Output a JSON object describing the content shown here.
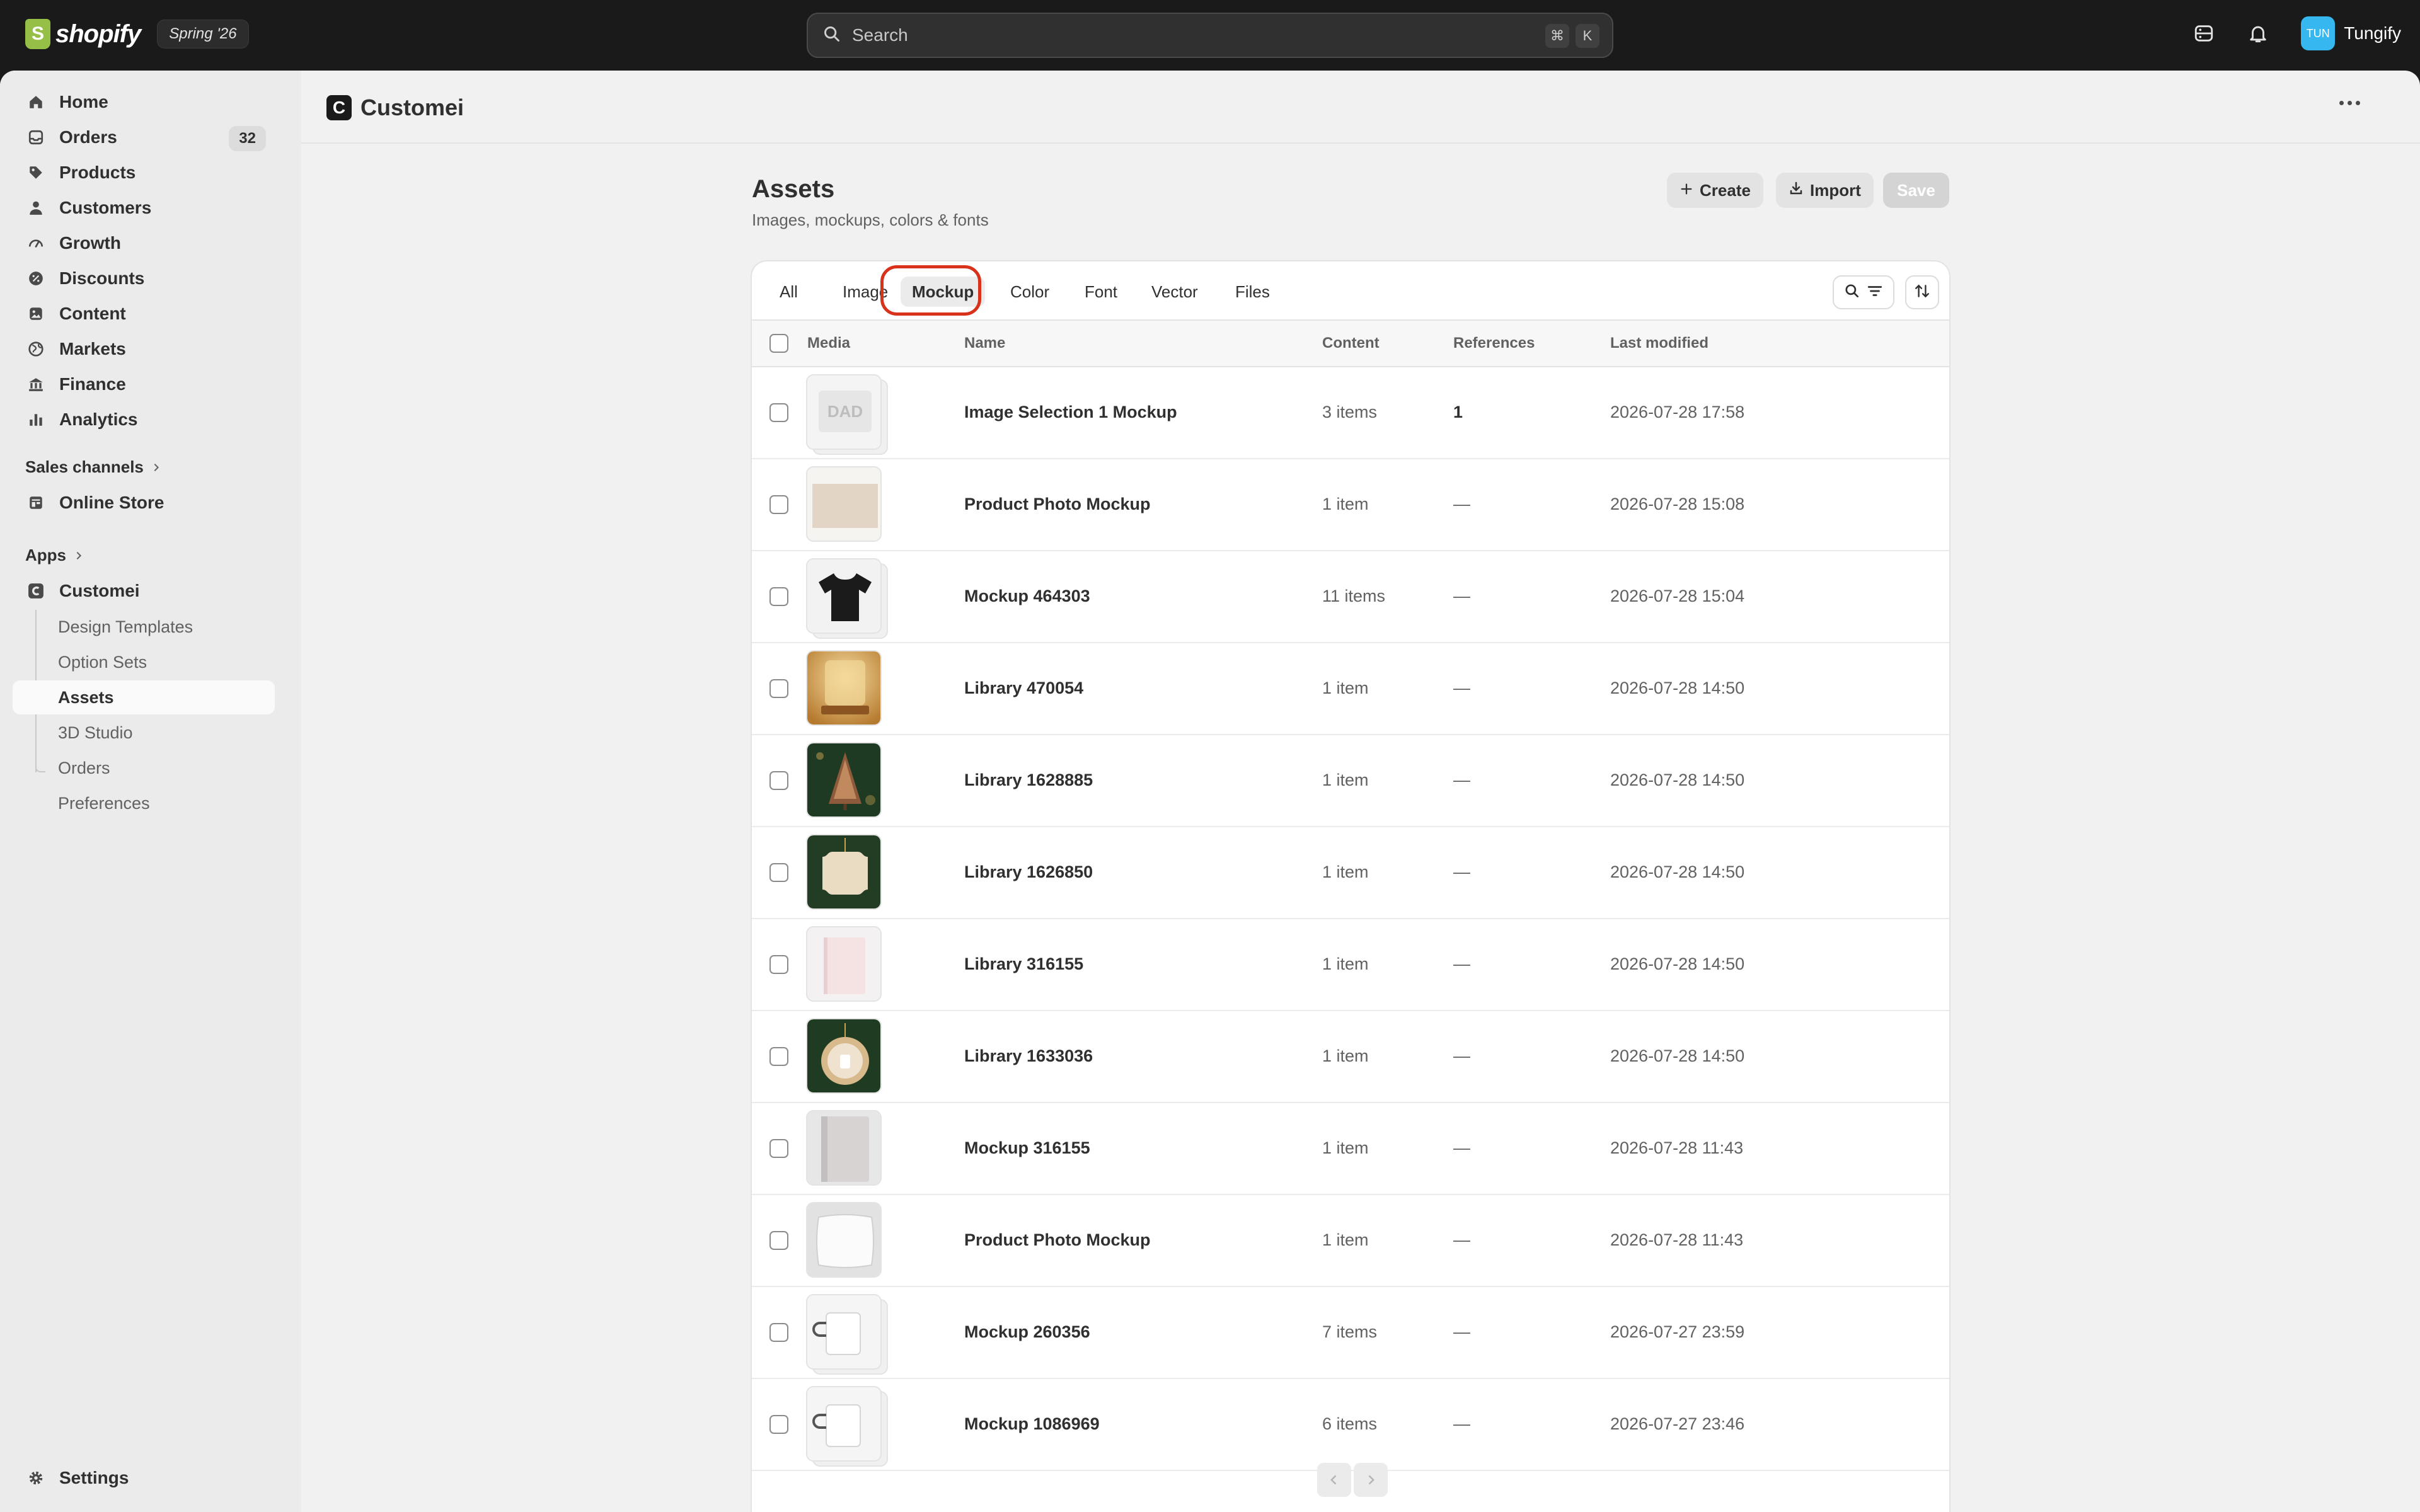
{
  "topbar": {
    "logo_text": "shopify",
    "edition": "Spring '26",
    "search_placeholder": "Search",
    "shortcut_cmd": "⌘",
    "shortcut_key": "K",
    "user_initials": "TUN",
    "user_name": "Tungify"
  },
  "sidebar": {
    "items": [
      {
        "label": "Home",
        "icon": "home-icon"
      },
      {
        "label": "Orders",
        "icon": "inbox-icon",
        "badge": "32"
      },
      {
        "label": "Products",
        "icon": "tag-icon"
      },
      {
        "label": "Customers",
        "icon": "person-icon"
      },
      {
        "label": "Growth",
        "icon": "gauge-icon"
      },
      {
        "label": "Discounts",
        "icon": "discount-icon"
      },
      {
        "label": "Content",
        "icon": "content-icon"
      },
      {
        "label": "Markets",
        "icon": "globe-icon"
      },
      {
        "label": "Finance",
        "icon": "bank-icon"
      },
      {
        "label": "Analytics",
        "icon": "chart-icon"
      }
    ],
    "sales_channels_label": "Sales channels",
    "online_store_label": "Online Store",
    "apps_label": "Apps",
    "app_name": "Customei",
    "app_sub_items": [
      {
        "label": "Design Templates"
      },
      {
        "label": "Option Sets"
      },
      {
        "label": "Assets",
        "active": true
      },
      {
        "label": "3D Studio"
      },
      {
        "label": "Orders"
      },
      {
        "label": "Preferences"
      }
    ],
    "settings_label": "Settings"
  },
  "app_header": {
    "logo_letter": "C",
    "title": "Customei"
  },
  "page": {
    "title": "Assets",
    "subtitle": "Images, mockups, colors & fonts",
    "create_label": "Create",
    "import_label": "Import",
    "save_label": "Save"
  },
  "tabs": [
    {
      "label": "All"
    },
    {
      "label": "Image"
    },
    {
      "label": "Mockup",
      "active": true
    },
    {
      "label": "Color"
    },
    {
      "label": "Font"
    },
    {
      "label": "Vector"
    },
    {
      "label": "Files"
    }
  ],
  "table": {
    "headers": {
      "media": "Media",
      "name": "Name",
      "content": "Content",
      "references": "References",
      "last_modified": "Last modified"
    },
    "rows": [
      {
        "name": "Image Selection 1 Mockup",
        "content": "3 items",
        "references": "1",
        "modified": "2026-07-28 17:58",
        "thumb": "dad"
      },
      {
        "name": "Product Photo Mockup",
        "content": "1 item",
        "references": "—",
        "modified": "2026-07-28 15:08",
        "thumb": "beige"
      },
      {
        "name": "Mockup 464303",
        "content": "11 items",
        "references": "—",
        "modified": "2026-07-28 15:04",
        "thumb": "tshirt"
      },
      {
        "name": "Library 470054",
        "content": "1 item",
        "references": "—",
        "modified": "2026-07-28 14:50",
        "thumb": "lamp"
      },
      {
        "name": "Library 1628885",
        "content": "1 item",
        "references": "—",
        "modified": "2026-07-28 14:50",
        "thumb": "tree"
      },
      {
        "name": "Library 1626850",
        "content": "1 item",
        "references": "—",
        "modified": "2026-07-28 14:50",
        "thumb": "plaque"
      },
      {
        "name": "Library 316155",
        "content": "1 item",
        "references": "—",
        "modified": "2026-07-28 14:50",
        "thumb": "notebook"
      },
      {
        "name": "Library 1633036",
        "content": "1 item",
        "references": "—",
        "modified": "2026-07-28 14:50",
        "thumb": "ornament"
      },
      {
        "name": "Mockup 316155",
        "content": "1 item",
        "references": "—",
        "modified": "2026-07-28 11:43",
        "thumb": "book"
      },
      {
        "name": "Product Photo Mockup",
        "content": "1 item",
        "references": "—",
        "modified": "2026-07-28 11:43",
        "thumb": "pillow"
      },
      {
        "name": "Mockup 260356",
        "content": "7 items",
        "references": "—",
        "modified": "2026-07-27 23:59",
        "thumb": "mug"
      },
      {
        "name": "Mockup 1086969",
        "content": "6 items",
        "references": "—",
        "modified": "2026-07-27 23:46",
        "thumb": "mug"
      }
    ]
  },
  "colors": {
    "accent_ring": "#d9321a",
    "avatar": "#36b7f0",
    "shopify_green": "#95bf47"
  }
}
